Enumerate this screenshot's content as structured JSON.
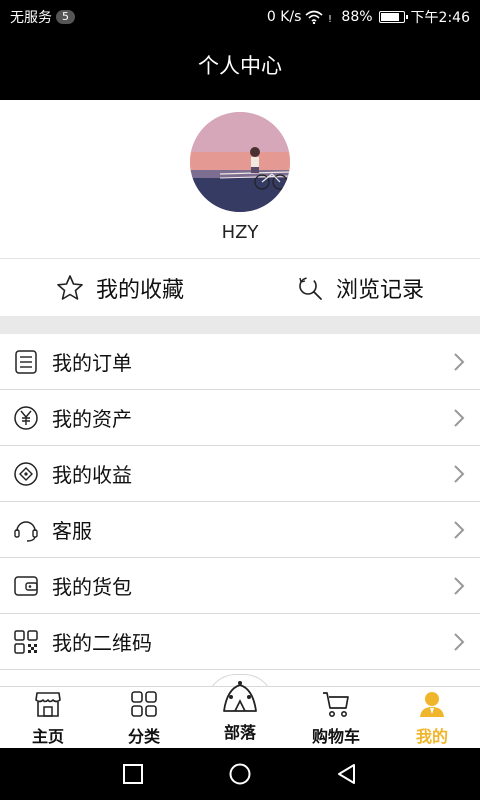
{
  "status_bar": {
    "carrier": "无服务",
    "sim_badge": "5",
    "network_speed": "0 K/s",
    "battery": "88%",
    "battery_level": 0.88,
    "time": "下午2:46"
  },
  "header": {
    "title": "个人中心"
  },
  "profile": {
    "username": "HZY"
  },
  "quick_actions": [
    {
      "label": "我的收藏",
      "icon": "star-icon"
    },
    {
      "label": "浏览记录",
      "icon": "history-search-icon"
    }
  ],
  "menu": [
    {
      "label": "我的订单",
      "icon": "order-list-icon"
    },
    {
      "label": "我的资产",
      "icon": "yen-icon"
    },
    {
      "label": "我的收益",
      "icon": "earnings-icon"
    },
    {
      "label": "客服",
      "icon": "headset-icon"
    },
    {
      "label": "我的货包",
      "icon": "wallet-icon"
    },
    {
      "label": "我的二维码",
      "icon": "qr-code-icon"
    }
  ],
  "tabbar": {
    "active_color": "#f0b52a",
    "items": [
      {
        "label": "主页",
        "icon": "storefront-icon"
      },
      {
        "label": "分类",
        "icon": "category-grid-icon"
      },
      {
        "label": "部落",
        "icon": "tent-icon"
      },
      {
        "label": "购物车",
        "icon": "cart-icon"
      },
      {
        "label": "我的",
        "icon": "user-icon",
        "active": true
      }
    ]
  },
  "navbar": {
    "buttons": [
      "recent-apps-icon",
      "home-circle-icon",
      "back-triangle-icon"
    ]
  }
}
